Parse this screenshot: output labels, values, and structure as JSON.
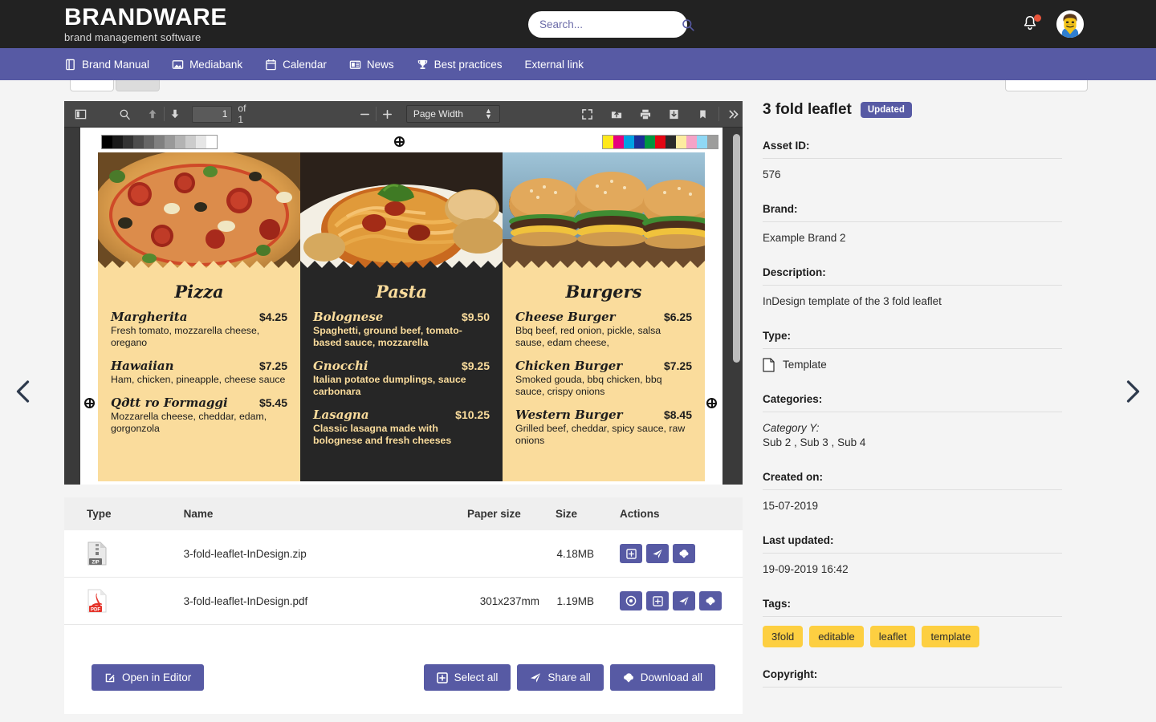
{
  "header": {
    "logo_main": "BRANDWARE",
    "logo_sub": "brand management software",
    "search_placeholder": "Search...",
    "search_value": ""
  },
  "nav": {
    "items": [
      {
        "label": "Brand Manual",
        "icon": "book-icon"
      },
      {
        "label": "Mediabank",
        "icon": "image-icon"
      },
      {
        "label": "Calendar",
        "icon": "calendar-icon"
      },
      {
        "label": "News",
        "icon": "newspaper-icon"
      },
      {
        "label": "Best practices",
        "icon": "trophy-icon"
      },
      {
        "label": "External link",
        "icon": "none"
      }
    ]
  },
  "pdf_toolbar": {
    "sidebar_toggle": "sidebar-toggle-icon",
    "find": "search-icon",
    "page_up": "arrow-up-icon",
    "page_down": "arrow-down-icon",
    "page_number": "1",
    "page_of": "of 1",
    "zoom_out": "minus-icon",
    "zoom_in": "plus-icon",
    "zoom_level": "Page Width",
    "zoom_options": [
      "Page Width"
    ],
    "presentation": "fullscreen-icon",
    "open_file": "open-file-icon",
    "print": "print-icon",
    "download": "download-icon",
    "bookmark": "bookmark-icon",
    "more": "chevrons-right-icon"
  },
  "leaflet": {
    "greybar_colors": [
      "#000000",
      "#1a1a1a",
      "#333333",
      "#4d4d4d",
      "#666666",
      "#808080",
      "#999999",
      "#b3b3b3",
      "#cccccc",
      "#e6e6e6",
      "#ffffff"
    ],
    "colorbar_colors": [
      "#ffe81a",
      "#e6007e",
      "#00a0e3",
      "#1a2f99",
      "#009640",
      "#e30613",
      "#2b2b2b",
      "#fdeca0",
      "#f5a3c7",
      "#8fd8f5",
      "#9d9d9c"
    ],
    "panels": [
      {
        "title": "Pizza",
        "theme": "light",
        "photo": "pizza-photo",
        "items": [
          {
            "name": "Margherita",
            "price": "$4.25",
            "desc": "Fresh tomato, mozzarella cheese, oregano"
          },
          {
            "name": "Hawaiian",
            "price": "$7.25",
            "desc": "Ham, chicken, pineapple, cheese sauce"
          },
          {
            "name": "Qдtt ro Formaggi",
            "price": "$5.45",
            "desc": "Mozzarella cheese, cheddar, edam, gorgonzola"
          }
        ]
      },
      {
        "title": "Pasta",
        "theme": "dark",
        "photo": "pasta-photo",
        "items": [
          {
            "name": "Bolognese",
            "price": "$9.50",
            "desc": "Spaghetti, ground beef, tomato-based sauce, mozzarella"
          },
          {
            "name": "Gnocchi",
            "price": "$9.25",
            "desc": "Italian potatoe dumplings, sauce carbonara"
          },
          {
            "name": "Lasagna",
            "price": "$10.25",
            "desc": "Classic lasagna made with bolognese and fresh cheeses"
          }
        ]
      },
      {
        "title": "Burgers",
        "theme": "light",
        "photo": "burger-photo",
        "items": [
          {
            "name": "Cheese Burger",
            "price": "$6.25",
            "desc": "Bbq beef, red onion, pickle, salsa sause, edam cheese,"
          },
          {
            "name": "Chicken Burger",
            "price": "$7.25",
            "desc": "Smoked gouda, bbq chicken, bbq sauce, crispy onions"
          },
          {
            "name": "Western Burger",
            "price": "$8.45",
            "desc": "Grilled beef, cheddar, spicy sauce, raw onions"
          }
        ]
      }
    ]
  },
  "files": {
    "columns": [
      "Type",
      "Name",
      "Paper size",
      "Size",
      "Actions"
    ],
    "rows": [
      {
        "type_icon": "zip-file-icon",
        "type_label": "ZIP",
        "name": "3-fold-leaflet-InDesign.zip",
        "paper_size": "",
        "size": "4.18MB",
        "actions": [
          "add-to-selection-icon",
          "share-icon",
          "download-icon"
        ]
      },
      {
        "type_icon": "pdf-file-icon",
        "type_label": "PDF",
        "name": "3-fold-leaflet-InDesign.pdf",
        "paper_size": "301x237mm",
        "size": "1.19MB",
        "actions": [
          "preview-icon",
          "add-to-selection-icon",
          "share-icon",
          "download-icon"
        ]
      }
    ],
    "buttons": {
      "open_in_editor": "Open in Editor",
      "select_all": "Select all",
      "share_all": "Share all",
      "download_all": "Download all"
    }
  },
  "detail": {
    "title": "3 fold leaflet",
    "badge": "Updated",
    "fields": [
      {
        "label": "Asset ID:",
        "value": "576"
      },
      {
        "label": "Brand:",
        "value": "Example Brand 2"
      },
      {
        "label": "Description:",
        "value": "InDesign template of the 3 fold leaflet"
      },
      {
        "label": "Type:",
        "value": "Template"
      },
      {
        "label": "Categories:",
        "group": "Category Y:",
        "value": "Sub 2 , Sub 3 , Sub 4"
      },
      {
        "label": "Created on:",
        "value": "15-07-2019"
      },
      {
        "label": "Last updated:",
        "value": "19-09-2019 16:42"
      },
      {
        "label": "Tags:",
        "value": ""
      },
      {
        "label": "Copyright:",
        "value": ""
      }
    ],
    "tags": [
      "3fold",
      "editable",
      "leaflet",
      "template"
    ]
  },
  "pager": {
    "prev": "chevron-left-icon",
    "next": "chevron-right-icon"
  },
  "colors": {
    "brand": "#575aa4",
    "dark": "#222222",
    "tag": "#fdcf41"
  }
}
